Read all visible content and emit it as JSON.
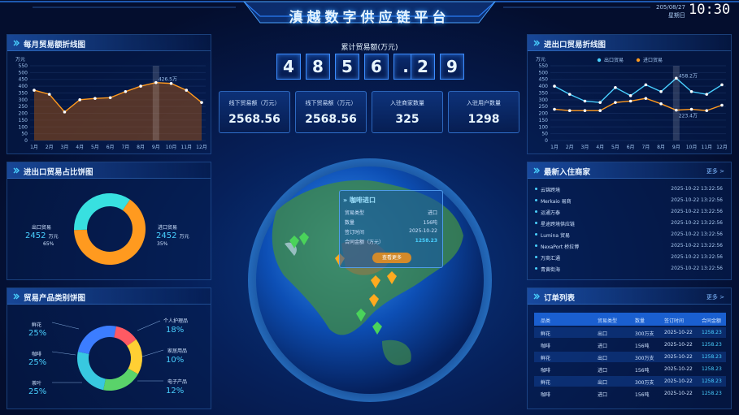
{
  "header": {
    "title": "滇越数字供应链平台",
    "date": "205/08/27",
    "weekday": "星期日",
    "time": "10:30"
  },
  "monthly": {
    "title": "每月贸易额折线图",
    "unit": "万元",
    "y_ticks": [
      "550",
      "500",
      "450",
      "400",
      "350",
      "300",
      "250",
      "200",
      "150",
      "100",
      "50",
      "0"
    ],
    "months": [
      "1月",
      "2月",
      "3月",
      "4月",
      "5月",
      "6月",
      "7月",
      "8月",
      "9月",
      "10月",
      "11月",
      "12月"
    ],
    "values": [
      370,
      340,
      210,
      300,
      310,
      315,
      360,
      400,
      426.5,
      420,
      370,
      280
    ],
    "highlight": "426.5万"
  },
  "share": {
    "title": "进出口贸易占比饼图",
    "export_label": "出口贸易",
    "export_value": "2452",
    "export_unit": "万元",
    "export_pct": "65%",
    "import_label": "进口贸易",
    "import_value": "2452",
    "import_unit": "万元",
    "import_pct": "35%",
    "colors": [
      "#ff9a1f",
      "#38e0e0"
    ],
    "fractions": [
      0.65,
      0.35
    ]
  },
  "category": {
    "title": "贸易产品类别饼图",
    "left": [
      {
        "name": "鲜花",
        "pct": "25%"
      },
      {
        "name": "咖啡",
        "pct": "25%"
      },
      {
        "name": "茶叶",
        "pct": "25%"
      }
    ],
    "right": [
      {
        "name": "个人护理品",
        "pct": "18%"
      },
      {
        "name": "家居用品",
        "pct": "10%"
      },
      {
        "name": "电子产品",
        "pct": "12%"
      }
    ],
    "colors": [
      "#ff5a63",
      "#ffcf33",
      "#5ad36a",
      "#38c8e0",
      "#3c7dff"
    ],
    "fractions": [
      0.12,
      0.18,
      0.2,
      0.25,
      0.25
    ]
  },
  "total": {
    "label": "累计贸易额(万元)",
    "digits": [
      "4",
      "8",
      "5",
      "6",
      ".",
      "2",
      "9"
    ]
  },
  "cards": [
    {
      "label": "线下贸易额（万元）",
      "value": "2568.56"
    },
    {
      "label": "线下贸易额（万元）",
      "value": "2568.56"
    },
    {
      "label": "入驻商家数量",
      "value": "325"
    },
    {
      "label": "入驻用户数量",
      "value": "1298"
    }
  ],
  "popup": {
    "title": "咖啡进口",
    "rows": [
      {
        "k": "贸易类型",
        "v": "进口"
      },
      {
        "k": "数量",
        "v": "156吨"
      },
      {
        "k": "签订时间",
        "v": "2025-10-22"
      },
      {
        "k": "合同金额（万元）",
        "v": "1258.23"
      }
    ],
    "button": "查看更多"
  },
  "io": {
    "title": "进出口贸易折线图",
    "unit": "万元",
    "legend_export": "出口贸易",
    "legend_import": "进口贸易",
    "y_ticks": [
      "550",
      "500",
      "450",
      "400",
      "350",
      "300",
      "250",
      "200",
      "150",
      "100",
      "50",
      "0"
    ],
    "months": [
      "1月",
      "2月",
      "3月",
      "4月",
      "5月",
      "6月",
      "7月",
      "8月",
      "9月",
      "10月",
      "11月",
      "12月"
    ],
    "export": [
      400,
      340,
      290,
      280,
      390,
      330,
      410,
      360,
      458.2,
      360,
      340,
      410
    ],
    "import": [
      230,
      220,
      220,
      220,
      280,
      290,
      310,
      270,
      223.4,
      230,
      220,
      260
    ],
    "export_label": "458.2万",
    "import_label": "223.4万",
    "colors": [
      "#49d0ff",
      "#ff9a1f"
    ]
  },
  "merchants": {
    "title": "最新入住商家",
    "more": "更多 >",
    "items": [
      {
        "n": "云锦跨境",
        "d": "2025-10-22 13:22:56"
      },
      {
        "n": "Merkaio 易商",
        "d": "2025-10-22 13:22:56"
      },
      {
        "n": "运通万泰",
        "d": "2025-10-22 13:22:56"
      },
      {
        "n": "星途跨境供应链",
        "d": "2025-10-22 13:22:56"
      },
      {
        "n": "Lumina 贸易",
        "d": "2025-10-22 13:22:56"
      },
      {
        "n": "NexaPort 桥拉博",
        "d": "2025-10-22 13:22:56"
      },
      {
        "n": "万商汇通",
        "d": "2025-10-22 13:22:56"
      },
      {
        "n": "青黄街海",
        "d": "2025-10-22 13:22:56"
      }
    ]
  },
  "orders": {
    "title": "订单列表",
    "more": "更多 >",
    "headers": [
      "品类",
      "贸易类型",
      "数量",
      "签订时间",
      "合同金额"
    ],
    "rows": [
      [
        "鲜花",
        "出口",
        "300万支",
        "2025-10-22",
        "1258.23"
      ],
      [
        "咖啡",
        "进口",
        "156吨",
        "2025-10-22",
        "1258.23"
      ],
      [
        "鲜花",
        "出口",
        "300万支",
        "2025-10-22",
        "1258.23"
      ],
      [
        "咖啡",
        "进口",
        "156吨",
        "2025-10-22",
        "1258.23"
      ],
      [
        "鲜花",
        "出口",
        "300万支",
        "2025-10-22",
        "1258.23"
      ],
      [
        "咖啡",
        "进口",
        "156吨",
        "2025-10-22",
        "1258.23"
      ]
    ]
  }
}
